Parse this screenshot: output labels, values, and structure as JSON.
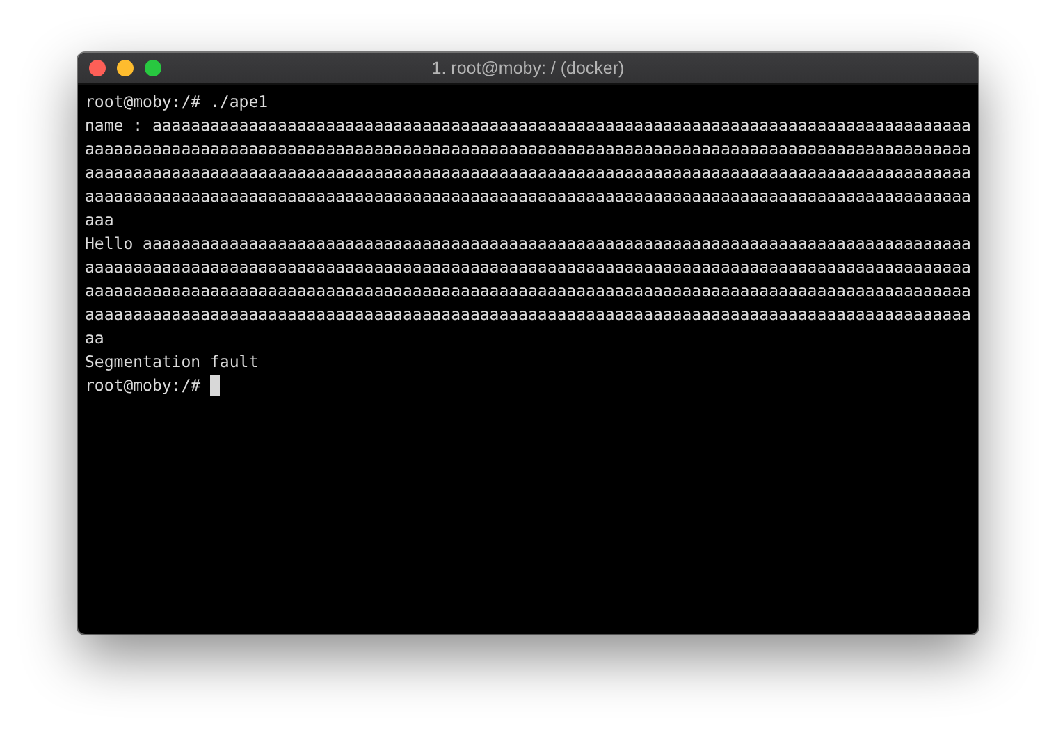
{
  "window": {
    "title": "1. root@moby: / (docker)"
  },
  "terminal": {
    "cursor": true,
    "lines": [
      "root@moby:/# ./ape1",
      "name : aaaaaaaaaaaaaaaaaaaaaaaaaaaaaaaaaaaaaaaaaaaaaaaaaaaaaaaaaaaaaaaaaaaaaaaaaaaaaaaaaaaaa",
      "aaaaaaaaaaaaaaaaaaaaaaaaaaaaaaaaaaaaaaaaaaaaaaaaaaaaaaaaaaaaaaaaaaaaaaaaaaaaaaaaaaaaaaaaaaaa",
      "aaaaaaaaaaaaaaaaaaaaaaaaaaaaaaaaaaaaaaaaaaaaaaaaaaaaaaaaaaaaaaaaaaaaaaaaaaaaaaaaaaaaaaaaaaaa",
      "aaaaaaaaaaaaaaaaaaaaaaaaaaaaaaaaaaaaaaaaaaaaaaaaaaaaaaaaaaaaaaaaaaaaaaaaaaaaaaaaaaaaaaaaaaaa",
      "aaa",
      "Hello aaaaaaaaaaaaaaaaaaaaaaaaaaaaaaaaaaaaaaaaaaaaaaaaaaaaaaaaaaaaaaaaaaaaaaaaaaaaaaaaaaaaaa",
      "aaaaaaaaaaaaaaaaaaaaaaaaaaaaaaaaaaaaaaaaaaaaaaaaaaaaaaaaaaaaaaaaaaaaaaaaaaaaaaaaaaaaaaaaaaaa",
      "aaaaaaaaaaaaaaaaaaaaaaaaaaaaaaaaaaaaaaaaaaaaaaaaaaaaaaaaaaaaaaaaaaaaaaaaaaaaaaaaaaaaaaaaaaaa",
      "aaaaaaaaaaaaaaaaaaaaaaaaaaaaaaaaaaaaaaaaaaaaaaaaaaaaaaaaaaaaaaaaaaaaaaaaaaaaaaaaaaaaaaaaaaaa",
      "aa",
      "Segmentation fault",
      "root@moby:/# "
    ]
  }
}
